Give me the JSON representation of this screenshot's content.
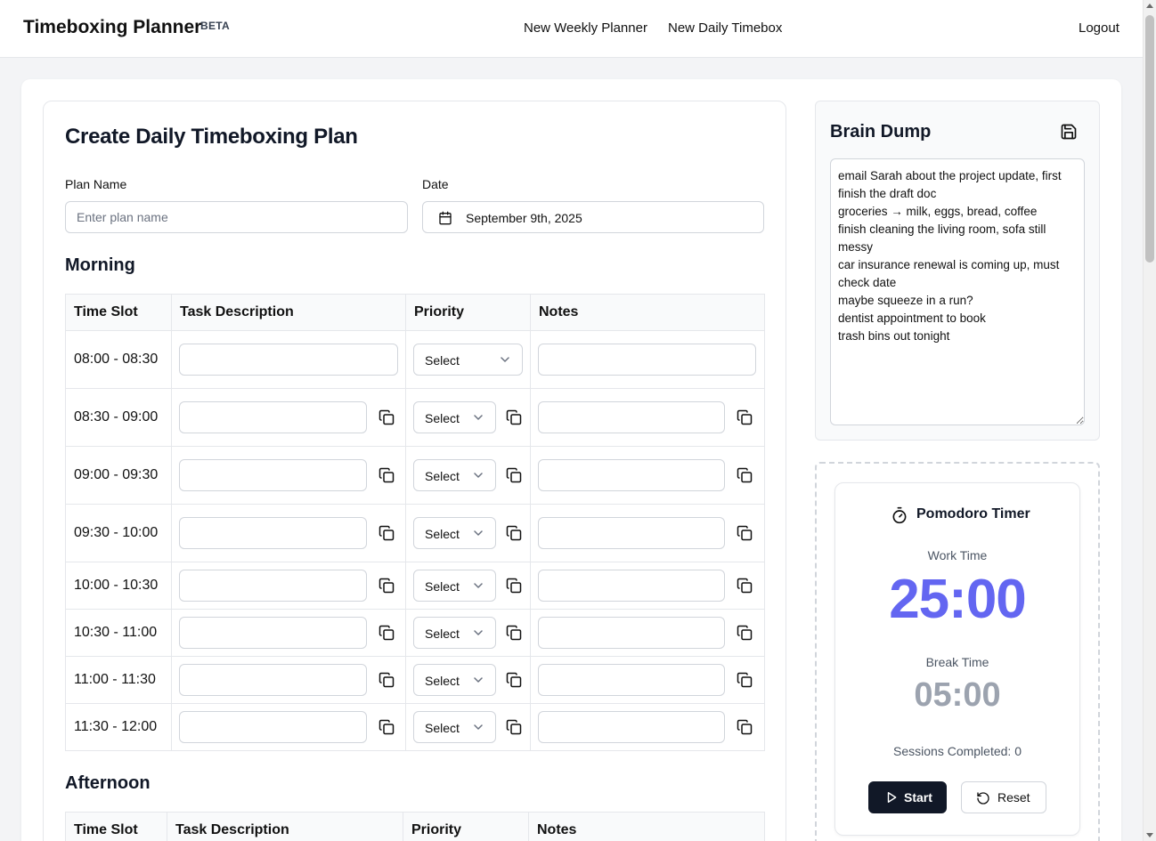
{
  "header": {
    "brand": "Timeboxing Planner",
    "badge": "BETA",
    "nav": [
      "New Weekly Planner",
      "New Daily Timebox"
    ],
    "logout": "Logout"
  },
  "form": {
    "title": "Create Daily Timeboxing Plan",
    "plan_name_label": "Plan Name",
    "plan_name_placeholder": "Enter plan name",
    "plan_name_value": "",
    "date_label": "Date",
    "date_value": "September 9th, 2025"
  },
  "table_headers": [
    "Time Slot",
    "Task Description",
    "Priority",
    "Notes"
  ],
  "priority_placeholder": "Select",
  "morning": {
    "title": "Morning",
    "slots": [
      {
        "time": "08:00 - 08:30",
        "task": "",
        "notes": ""
      },
      {
        "time": "08:30 - 09:00",
        "task": "",
        "notes": ""
      },
      {
        "time": "09:00 - 09:30",
        "task": "",
        "notes": ""
      },
      {
        "time": "09:30 - 10:00",
        "task": "",
        "notes": ""
      },
      {
        "time": "10:00 - 10:30",
        "task": "",
        "notes": ""
      },
      {
        "time": "10:30 - 11:00",
        "task": "",
        "notes": ""
      },
      {
        "time": "11:00 - 11:30",
        "task": "",
        "notes": ""
      },
      {
        "time": "11:30 - 12:00",
        "task": "",
        "notes": ""
      }
    ]
  },
  "afternoon": {
    "title": "Afternoon"
  },
  "brain_dump": {
    "title": "Brain Dump",
    "text": "email Sarah about the project update, first finish the draft doc\ngroceries → milk, eggs, bread, coffee\nfinish cleaning the living room, sofa still messy\ncar insurance renewal is coming up, must check date\nmaybe squeeze in a run?\ndentist appointment to book\ntrash bins out tonight"
  },
  "pomodoro": {
    "title": "Pomodoro Timer",
    "work_label": "Work Time",
    "work_time": "25:00",
    "break_label": "Break Time",
    "break_time": "05:00",
    "sessions_text": "Sessions Completed: 0",
    "start_label": "Start",
    "reset_label": "Reset"
  },
  "colors": {
    "accent": "#6366f1",
    "dark_button": "#111827",
    "muted": "#9ca3af"
  }
}
